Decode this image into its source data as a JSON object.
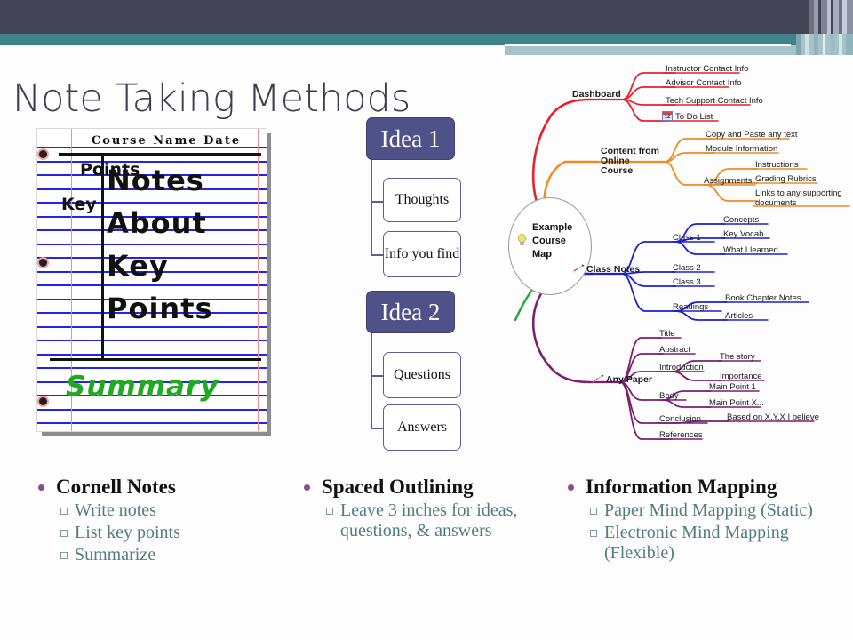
{
  "slide": {
    "title": "Note Taking Methods",
    "background": "#fdfdfd",
    "accent_dark": "#434557",
    "accent_teal": "#3f8289",
    "accent_pale": "#a5c3c9",
    "bullet_color": "#8f4a8f",
    "sub_text_color": "#4f7d83"
  },
  "cornell_image": {
    "name": "cornell-notes-handwritten-page",
    "header": "Course Name Date",
    "cue_column_word_1": "Key",
    "cue_column_word_2": "Points",
    "body_lines": [
      "Notes",
      "About",
      "Key",
      "Points"
    ],
    "summary": "Summary",
    "summary_color": "#1faa22",
    "rule_color": "#2323ee",
    "margin_color": "#f28d8d"
  },
  "outline_diagram": {
    "name": "spaced-outlining-diagram",
    "head_fill": "#4e5288",
    "leaf_border": "#5a5f93",
    "groups": [
      {
        "head": "Idea 1",
        "leaves": [
          "Thoughts",
          "Info you find"
        ]
      },
      {
        "head": "Idea 2",
        "leaves": [
          "Questions",
          "Answers"
        ]
      }
    ]
  },
  "mind_map": {
    "name": "example-course-mind-map",
    "center": "Example Course Map",
    "center_icon": "lightbulb-icon",
    "branches": [
      {
        "label": "Dashboard",
        "color": "#e8202a",
        "icon": null,
        "children": [
          {
            "label": "Instructor Contact Info"
          },
          {
            "label": "Advisor Contact Info"
          },
          {
            "label": "Tech Support Contact Info"
          },
          {
            "label": "To Do List",
            "icon": "calendar-icon"
          }
        ]
      },
      {
        "label": "Content from Online Course",
        "color": "#ee8b22",
        "icon": "info-icon",
        "children": [
          {
            "label": "Copy and Paste any text"
          },
          {
            "label": "Module Information"
          },
          {
            "label": "Assignments",
            "children": [
              {
                "label": "Instructions"
              },
              {
                "label": "Grading Rubrics"
              },
              {
                "label": "Links to any supporting documents"
              }
            ]
          }
        ]
      },
      {
        "label": "Class Notes",
        "color": "#1f1fd0",
        "icon": "pencil-icon",
        "children": [
          {
            "label": "Class 1",
            "children": [
              {
                "label": "Concepts"
              },
              {
                "label": "Key Vocab"
              },
              {
                "label": "What I learned"
              }
            ]
          },
          {
            "label": "Class 2"
          },
          {
            "label": "Class 3"
          },
          {
            "label": "Readings",
            "children": [
              {
                "label": "Book Chapter Notes"
              },
              {
                "label": "Articles"
              }
            ]
          }
        ]
      },
      {
        "label": "Any Paper",
        "color": "#7b1f6e",
        "icon": "pencil-icon",
        "children": [
          {
            "label": "Title"
          },
          {
            "label": "Abstract"
          },
          {
            "label": "Introduction",
            "children": [
              {
                "label": "The story"
              },
              {
                "label": "Importance"
              }
            ]
          },
          {
            "label": "Body",
            "children": [
              {
                "label": "Main Point 1"
              },
              {
                "label": "Main Point X..."
              }
            ]
          },
          {
            "label": "Conclusion",
            "children": [
              {
                "label": "Based on X,Y,X I believe"
              }
            ]
          },
          {
            "label": "References"
          }
        ]
      }
    ]
  },
  "columns": [
    {
      "heading": "Cornell Notes",
      "items": [
        "Write notes",
        "List key points",
        "Summarize"
      ]
    },
    {
      "heading": "Spaced Outlining",
      "items": [
        "Leave 3 inches for ideas, questions, & answers"
      ]
    },
    {
      "heading": "Information Mapping",
      "items": [
        "Paper Mind Mapping (Static)",
        "Electronic Mind Mapping (Flexible)"
      ]
    }
  ]
}
